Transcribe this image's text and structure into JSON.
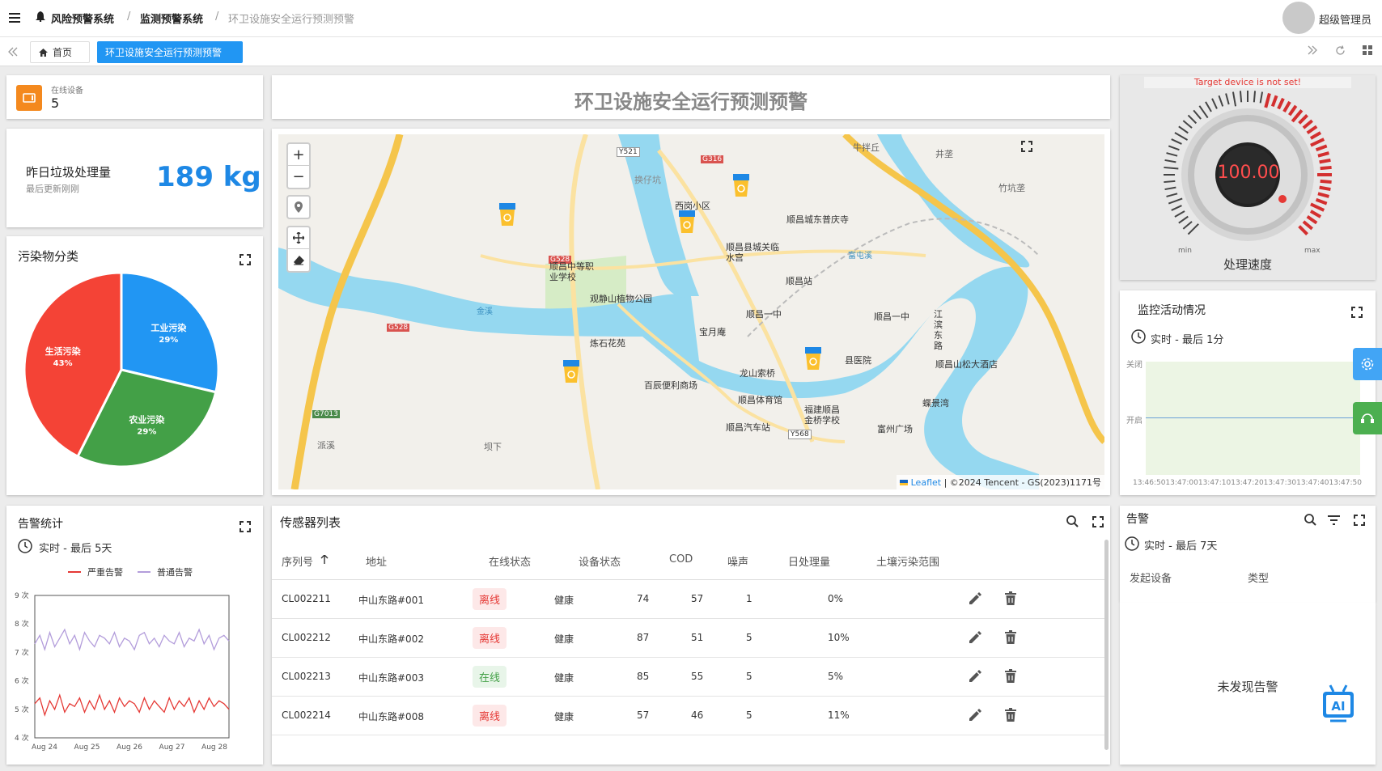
{
  "header": {
    "breadcrumb": [
      "风险预警系统",
      "监测预警系统",
      "环卫设施安全运行预测预警"
    ],
    "user": "超级管理员"
  },
  "tabs": [
    {
      "label": "首页",
      "active": false
    },
    {
      "label": "环卫设施安全运行预测预警",
      "active": true
    }
  ],
  "page_title": "环卫设施安全运行预测预警",
  "online_devices": {
    "label": "在线设备",
    "value": "5"
  },
  "waste": {
    "label": "昨日垃圾处理量",
    "sub": "最后更新刚刚",
    "value": "189 kg"
  },
  "pie": {
    "title": "污染物分类",
    "chart_data": {
      "type": "pie",
      "slices": [
        {
          "label": "工业污染",
          "value": 29,
          "pct": "29%",
          "color": "#2196f3"
        },
        {
          "label": "农业污染",
          "value": 29,
          "pct": "29%",
          "color": "#43a047"
        },
        {
          "label": "生活污染",
          "value": 43,
          "pct": "43%",
          "color": "#f44336"
        }
      ]
    }
  },
  "map": {
    "attribution_leaflet": "Leaflet",
    "attribution_rest": " | ©2024 Tencent - GS(2023)1171号",
    "labels": [
      "牛拌丘",
      "井垄",
      "竹坑垄",
      "换仔坑",
      "西岗小区",
      "顺昌城东普庆寺",
      "顺昌县城关临水宫",
      "顺昌中等职业学校",
      "观静山植物公园",
      "顺昌站",
      "富屯溪",
      "顺昌一中",
      "顺昌一中",
      "宝月庵",
      "炼石花苑",
      "金溪",
      "龙山索桥",
      "县医院",
      "顺昌山松大酒店",
      "江滨东路",
      "百辰便利商场",
      "顺昌体育馆",
      "福建顺昌金桥学校",
      "蝶景湾",
      "顺昌汽车站",
      "富州广场",
      "派溪",
      "坝下"
    ],
    "road_labels": [
      "Y521",
      "G316",
      "G528",
      "G528",
      "G7013",
      "Y568"
    ]
  },
  "gauge": {
    "warning": "Target device is not set!",
    "value": "100.00",
    "min": "min",
    "max": "max",
    "label": "处理速度",
    "level": 1.0
  },
  "monitor": {
    "title": "监控活动情况",
    "range": "实时 - 最后 1分",
    "y_labels": [
      "关闭",
      "开启"
    ],
    "x_ticks": "13:46:5013:47:0013:47:1013:47:2013:47:3013:47:4013:47:50"
  },
  "alarm_stats": {
    "title": "告警统计",
    "range": "实时 - 最后 5天",
    "legend": [
      "严重告警",
      "普通告警"
    ],
    "chart_data": {
      "type": "line",
      "x": [
        "Aug 24",
        "Aug 25",
        "Aug 26",
        "Aug 27",
        "Aug 28"
      ],
      "ylim": [
        4,
        9
      ],
      "yticks": [
        "9 次",
        "8 次",
        "7 次",
        "6 次",
        "5 次",
        "4 次"
      ],
      "series": [
        {
          "name": "严重告警",
          "color": "#e53935",
          "values": [
            5.2,
            5.4,
            4.8,
            5.3,
            5.0,
            5.5,
            4.9,
            5.2,
            5.1,
            5.4,
            4.9,
            5.3,
            5.0,
            5.5,
            5.0,
            5.3,
            4.9,
            5.4,
            5.1,
            5.3,
            5.2,
            4.9,
            5.4,
            5.0,
            5.3,
            5.1,
            4.9,
            5.4,
            5.0,
            5.3,
            5.1,
            5.4,
            4.9,
            5.3,
            5.0,
            5.4,
            5.1,
            5.3,
            5.2,
            5.0
          ]
        },
        {
          "name": "普通告警",
          "color": "#b39ddb",
          "values": [
            7.3,
            7.6,
            7.1,
            7.7,
            7.2,
            7.5,
            7.8,
            7.3,
            7.6,
            7.1,
            7.7,
            7.4,
            7.2,
            7.6,
            7.5,
            7.3,
            7.7,
            7.2,
            7.5,
            7.4,
            7.1,
            7.6,
            7.7,
            7.3,
            7.5,
            7.2,
            7.6,
            7.4,
            7.3,
            7.7,
            7.2,
            7.5,
            7.4,
            7.8,
            7.3,
            7.6,
            7.1,
            7.5,
            7.6,
            7.4
          ]
        }
      ]
    }
  },
  "sensors": {
    "title": "传感器列表",
    "columns": [
      "序列号",
      "地址",
      "在线状态",
      "设备状态",
      "COD",
      "噪声",
      "日处理量",
      "土壤污染范围"
    ],
    "rows": [
      {
        "id": "CL002211",
        "addr": "中山东路#001",
        "status": "离线",
        "online": false,
        "health": "健康",
        "cod": "74",
        "noise": "57",
        "daily": "1",
        "soil": "0%"
      },
      {
        "id": "CL002212",
        "addr": "中山东路#002",
        "status": "离线",
        "online": false,
        "health": "健康",
        "cod": "87",
        "noise": "51",
        "daily": "5",
        "soil": "10%"
      },
      {
        "id": "CL002213",
        "addr": "中山东路#003",
        "status": "在线",
        "online": true,
        "health": "健康",
        "cod": "85",
        "noise": "55",
        "daily": "5",
        "soil": "5%"
      },
      {
        "id": "CL002214",
        "addr": "中山东路#008",
        "status": "离线",
        "online": false,
        "health": "健康",
        "cod": "57",
        "noise": "46",
        "daily": "5",
        "soil": "11%"
      }
    ]
  },
  "alarms": {
    "title": "告警",
    "range": "实时 - 最后 7天",
    "columns": [
      "发起设备",
      "类型"
    ],
    "empty": "未发现告警"
  },
  "colors": {
    "accent": "#2196f3",
    "warning_orange": "#f4891e",
    "danger": "#e53935",
    "success": "#43a047"
  }
}
